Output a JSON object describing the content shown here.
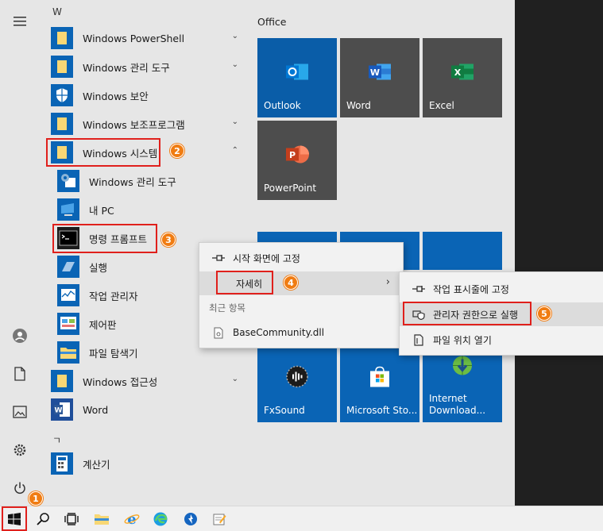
{
  "start_menu": {
    "letter_headers": [
      "W",
      "ㄱ"
    ],
    "apps": [
      {
        "label": "Windows PowerShell",
        "icon": "folder-icon"
      },
      {
        "label": "Windows 관리 도구",
        "icon": "folder-icon"
      },
      {
        "label": "Windows 보안",
        "icon": "shield-icon"
      },
      {
        "label": "Windows 보조프로그램",
        "icon": "folder-icon"
      },
      {
        "label": "Windows 시스템",
        "icon": "folder-icon",
        "expanded": true
      },
      {
        "label": "Windows 관리 도구",
        "icon": "admin-tools-icon"
      },
      {
        "label": "내 PC",
        "icon": "pc-icon"
      },
      {
        "label": "명령 프롬프트",
        "icon": "cmd-icon"
      },
      {
        "label": "실행",
        "icon": "run-icon"
      },
      {
        "label": "작업 관리자",
        "icon": "task-manager-icon"
      },
      {
        "label": "제어판",
        "icon": "control-panel-icon"
      },
      {
        "label": "파일 탐색기",
        "icon": "file-explorer-icon"
      },
      {
        "label": "Windows 접근성",
        "icon": "folder-icon"
      },
      {
        "label": "Word",
        "icon": "word-icon"
      },
      {
        "label": "계산기",
        "icon": "calculator-icon"
      }
    ]
  },
  "tiles": {
    "group_title": "Office",
    "items": [
      {
        "label": "Outlook",
        "color": "#0a5da8"
      },
      {
        "label": "Word",
        "color": "#4d4d4d"
      },
      {
        "label": "Excel",
        "color": "#4d4d4d"
      },
      {
        "label": "PowerPoint",
        "color": "#4d4d4d"
      },
      {
        "label": "FxSound",
        "color": "#0a64b5"
      },
      {
        "label": "Microsoft Sto...",
        "color": "#0a64b5"
      },
      {
        "label": "Internet Download...",
        "color": "#0a64b5"
      }
    ]
  },
  "context_menu": {
    "items": [
      "시작 화면에 고정",
      "자세히",
      "최근 항목",
      "BaseCommunity.dll"
    ]
  },
  "submenu": {
    "items": [
      "작업 표시줄에 고정",
      "관리자 권한으로 실행",
      "파일 위치 열기"
    ]
  },
  "steps": [
    "1",
    "2",
    "3",
    "4",
    "5"
  ],
  "colors": {
    "accent": "#0a64b5",
    "highlight": "#e0201c",
    "badge": "#f07c12",
    "folder": "#f8d775"
  }
}
